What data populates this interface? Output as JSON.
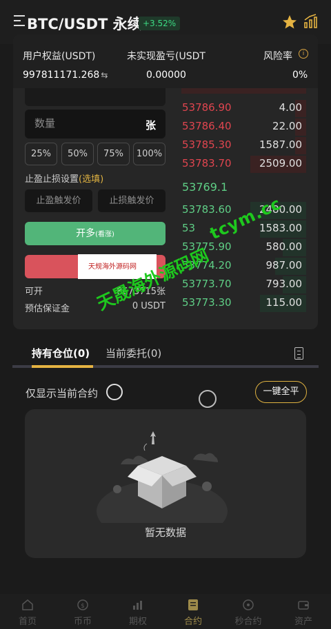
{
  "header": {
    "title": "BTC/USDT 永续",
    "change_badge": "+3.52%",
    "star_color": "#e5b342"
  },
  "account": {
    "equity_label": "用户权益(USDT)",
    "equity_value": "997811171.268",
    "unrealized_label": "未实现盈亏(USDT",
    "unrealized_value": "0.00000",
    "risk_label": "风险率",
    "risk_value": "0%"
  },
  "order_form": {
    "quantity_placeholder": "数量",
    "quantity_unit": "张",
    "percent_buttons": [
      "25%",
      "50%",
      "75%",
      "100%"
    ],
    "tpsl_title": "止盈止损设置",
    "tpsl_optional": "(选填)",
    "take_profit_placeholder": "止盈触发价",
    "stop_loss_placeholder": "止损触发价",
    "long_label": "开多",
    "long_sub": "(看涨)",
    "available_label": "可开",
    "available_value": "8673715张",
    "margin_label": "预估保证金",
    "margin_value": "0 USDT"
  },
  "orderbook": {
    "asks": [
      {
        "price": "53786.90",
        "qty": "4.00",
        "depth": 0.09
      },
      {
        "price": "53786.40",
        "qty": "22.00",
        "depth": 0.09
      },
      {
        "price": "53785.30",
        "qty": "1587.00",
        "depth": 0.09
      },
      {
        "price": "53783.70",
        "qty": "2509.00",
        "depth": 0.45
      }
    ],
    "last_price": "53769.1",
    "bids": [
      {
        "price": "53783.60",
        "qty": "2480.00",
        "depth": 0.45
      },
      {
        "price": "53",
        "qty": "1583.00",
        "depth": 0.37
      },
      {
        "price": "53775.90",
        "qty": "580.00",
        "depth": 0.19
      },
      {
        "price": "53774.20",
        "qty": "987.00",
        "depth": 0.25
      },
      {
        "price": "53773.70",
        "qty": "793.00",
        "depth": 0.19
      },
      {
        "price": "53773.30",
        "qty": "115.00",
        "depth": 0.37
      }
    ],
    "ask_color": "#e0454f",
    "bid_color": "#5fcf86"
  },
  "tabs": {
    "positions": "持有仓位(0)",
    "orders": "当前委托(0)"
  },
  "positions": {
    "filter_label": "仅显示当前合约",
    "close_all": "一键全平",
    "empty_text": "暂无数据"
  },
  "watermark": {
    "small": "天规海外源码网",
    "main": "天晟海外源码网",
    "url": "tcym.cc"
  },
  "nav": [
    {
      "label": "首页",
      "icon": "home-icon",
      "active": false
    },
    {
      "label": "币币",
      "icon": "coin-icon",
      "active": false
    },
    {
      "label": "期权",
      "icon": "options-icon",
      "active": false
    },
    {
      "label": "合约",
      "icon": "contract-icon",
      "active": true
    },
    {
      "label": "秒合约",
      "icon": "timer-icon",
      "active": false
    },
    {
      "label": "资产",
      "icon": "wallet-icon",
      "active": false
    }
  ]
}
